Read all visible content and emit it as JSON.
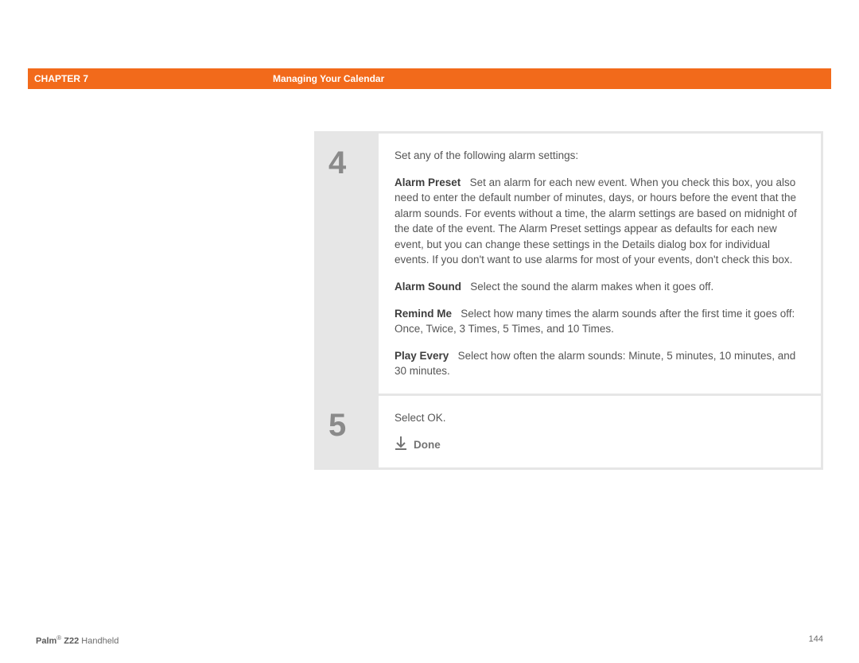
{
  "header": {
    "chapter_label": "CHAPTER 7",
    "title": "Managing Your Calendar"
  },
  "steps": [
    {
      "number": "4",
      "intro": "Set any of the following alarm settings:",
      "settings": [
        {
          "label": "Alarm Preset",
          "desc": "Set an alarm for each new event. When you check this box, you also need to enter the default number of minutes, days, or hours before the event that the alarm sounds. For events without a time, the alarm settings are based on midnight of the date of the event. The Alarm Preset settings appear as defaults for each new event, but you can change these settings in the Details dialog box for individual events. If you don't want to use alarms for most of your events, don't check this box."
        },
        {
          "label": "Alarm Sound",
          "desc": "Select the sound the alarm makes when it goes off."
        },
        {
          "label": "Remind Me",
          "desc": "Select how many times the alarm sounds after the first time it goes off: Once, Twice, 3 Times, 5 Times, and 10 Times."
        },
        {
          "label": "Play Every",
          "desc": "Select how often the alarm sounds: Minute, 5 minutes, 10 minutes, and 30 minutes."
        }
      ]
    },
    {
      "number": "5",
      "intro": "Select OK.",
      "done_label": "Done"
    }
  ],
  "footer": {
    "product_bold": "Palm",
    "product_reg": "®",
    "product_model": " Z22",
    "product_suffix": " Handheld",
    "page_number": "144"
  }
}
